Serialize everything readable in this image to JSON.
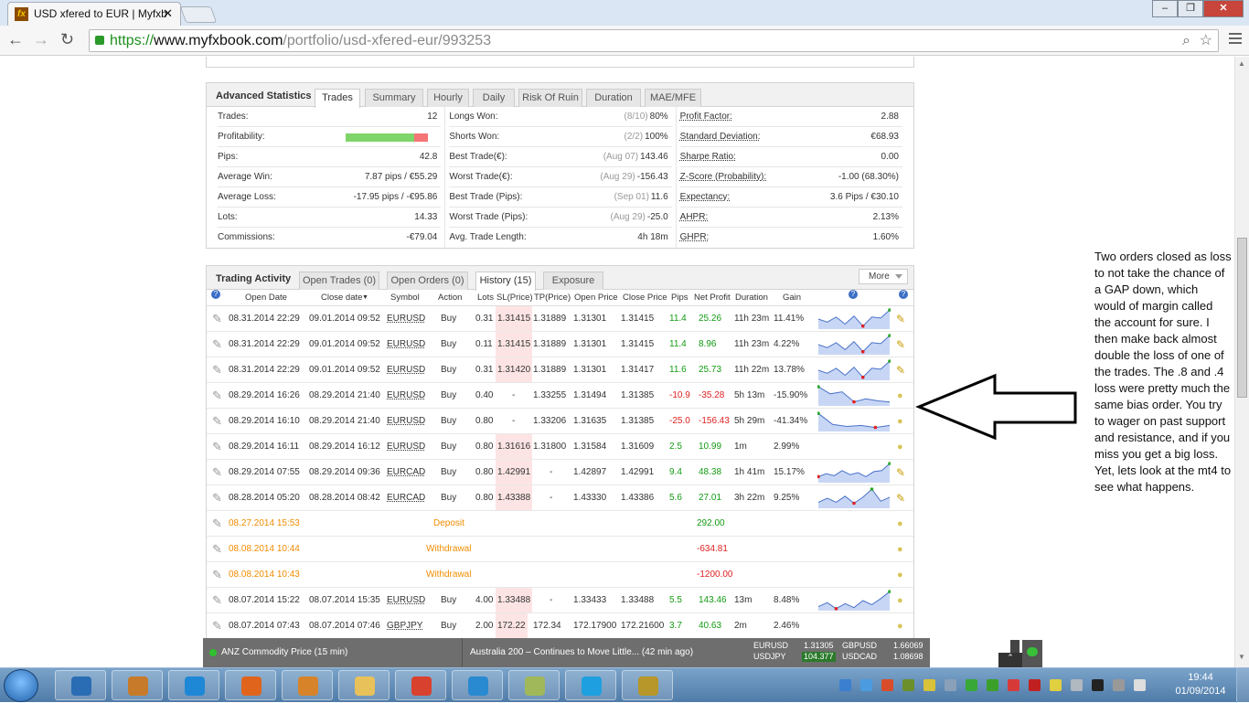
{
  "browser": {
    "tab_title": "USD xfered to EUR | Myfxb",
    "url_scheme": "https://",
    "url_host": "www.myfxbook.com",
    "url_path": "/portfolio/usd-xfered-eur/993253"
  },
  "advanced_statistics": {
    "title": "Advanced Statistics",
    "tabs": [
      "Trades",
      "Summary",
      "Hourly",
      "Daily",
      "Risk Of Ruin",
      "Duration",
      "MAE/MFE"
    ],
    "active_tab": "Trades",
    "col1": [
      {
        "label": "Trades:",
        "value": "12"
      },
      {
        "label": "Profitability:",
        "value": ""
      },
      {
        "label": "Pips:",
        "value": "42.8"
      },
      {
        "label": "Average Win:",
        "value": "7.87 pips / €55.29"
      },
      {
        "label": "Average Loss:",
        "value": "-17.95 pips / -€95.86"
      },
      {
        "label": "Lots:",
        "value": "14.33"
      },
      {
        "label": "Commissions:",
        "value": "-€79.04"
      }
    ],
    "profitability_fraction": 0.83,
    "col2": [
      {
        "label": "Longs Won:",
        "gray": "(8/10)",
        "value": "80%"
      },
      {
        "label": "Shorts Won:",
        "gray": "(2/2)",
        "value": "100%"
      },
      {
        "label": "Best Trade(€):",
        "gray": "(Aug 07)",
        "value": "143.46"
      },
      {
        "label": "Worst Trade(€):",
        "gray": "(Aug 29)",
        "value": "-156.43"
      },
      {
        "label": "Best Trade (Pips):",
        "gray": "(Sep 01)",
        "value": "11.6"
      },
      {
        "label": "Worst Trade (Pips):",
        "gray": "(Aug 29)",
        "value": "-25.0"
      },
      {
        "label": "Avg. Trade Length:",
        "gray": "",
        "value": "4h 18m"
      }
    ],
    "col3": [
      {
        "label": "Profit Factor:",
        "value": "2.88"
      },
      {
        "label": "Standard Deviation:",
        "value": "€68.93"
      },
      {
        "label": "Sharpe Ratio:",
        "value": "0.00"
      },
      {
        "label": "Z-Score (Probability):",
        "value": "-1.00 (68.30%)"
      },
      {
        "label": "Expectancy:",
        "value": "3.6 Pips / €30.10"
      },
      {
        "label": "AHPR:",
        "value": "2.13%"
      },
      {
        "label": "GHPR:",
        "value": "1.60%"
      }
    ]
  },
  "trading_activity": {
    "title": "Trading Activity",
    "tabs": [
      "Open Trades (0)",
      "Open Orders (0)",
      "History (15)",
      "Exposure"
    ],
    "active_tab": "History (15)",
    "more_label": "More",
    "columns": [
      "Open Date",
      "Close date",
      "Symbol",
      "Action",
      "Lots",
      "SL(Price)",
      "TP(Price)",
      "Open Price",
      "Close Price",
      "Pips",
      "Net Profit",
      "Duration",
      "Gain"
    ],
    "rows": [
      {
        "open": "08.31.2014 22:29",
        "close": "09.01.2014 09:52",
        "symbol": "EURUSD",
        "action": "Buy",
        "lots": "0.31",
        "sl": "1.31415",
        "tp": "1.31889",
        "op": "1.31301",
        "cp": "1.31415",
        "pips": "11.4",
        "profit": "25.26",
        "dur": "11h 23m",
        "gain": "11.41%",
        "spark": [
          0.5,
          0.35,
          0.6,
          0.25,
          0.65,
          0.15,
          0.6,
          0.55,
          0.95
        ],
        "icon": "edit"
      },
      {
        "open": "08.31.2014 22:29",
        "close": "09.01.2014 09:52",
        "symbol": "EURUSD",
        "action": "Buy",
        "lots": "0.11",
        "sl": "1.31415",
        "tp": "1.31889",
        "op": "1.31301",
        "cp": "1.31415",
        "pips": "11.4",
        "profit": "8.96",
        "dur": "11h 23m",
        "gain": "4.22%",
        "spark": [
          0.5,
          0.35,
          0.6,
          0.25,
          0.65,
          0.15,
          0.6,
          0.55,
          0.95
        ],
        "icon": "edit"
      },
      {
        "open": "08.31.2014 22:29",
        "close": "09.01.2014 09:52",
        "symbol": "EURUSD",
        "action": "Buy",
        "lots": "0.31",
        "sl": "1.31420",
        "tp": "1.31889",
        "op": "1.31301",
        "cp": "1.31417",
        "pips": "11.6",
        "profit": "25.73",
        "dur": "11h 22m",
        "gain": "13.78%",
        "spark": [
          0.5,
          0.35,
          0.6,
          0.25,
          0.65,
          0.15,
          0.6,
          0.55,
          0.95
        ],
        "icon": "edit"
      },
      {
        "open": "08.29.2014 16:26",
        "close": "08.29.2014 21:40",
        "symbol": "EURUSD",
        "action": "Buy",
        "lots": "0.40",
        "sl": "-",
        "tp": "1.33255",
        "op": "1.31494",
        "cp": "1.31385",
        "pips": "-10.9",
        "profit": "-35.28",
        "dur": "5h 13m",
        "gain": "-15.90%",
        "spark": [
          0.95,
          0.6,
          0.7,
          0.2,
          0.35,
          0.25,
          0.2
        ],
        "icon": "note"
      },
      {
        "open": "08.29.2014 16:10",
        "close": "08.29.2014 21:40",
        "symbol": "EURUSD",
        "action": "Buy",
        "lots": "0.80",
        "sl": "-",
        "tp": "1.33206",
        "op": "1.31635",
        "cp": "1.31385",
        "pips": "-25.0",
        "profit": "-156.43",
        "dur": "5h 29m",
        "gain": "-41.34%",
        "spark": [
          0.9,
          0.35,
          0.25,
          0.3,
          0.2,
          0.3
        ],
        "icon": "note"
      },
      {
        "open": "08.29.2014 16:11",
        "close": "08.29.2014 16:12",
        "symbol": "EURUSD",
        "action": "Buy",
        "lots": "0.80",
        "sl": "1.31616",
        "tp": "1.31800",
        "op": "1.31584",
        "cp": "1.31609",
        "pips": "2.5",
        "profit": "10.99",
        "dur": "1m",
        "gain": "2.99%",
        "spark": [],
        "icon": "note"
      },
      {
        "open": "08.29.2014 07:55",
        "close": "08.29.2014 09:36",
        "symbol": "EURCAD",
        "action": "Buy",
        "lots": "0.80",
        "sl": "1.42991",
        "tp": "-",
        "op": "1.42897",
        "cp": "1.42991",
        "pips": "9.4",
        "profit": "48.38",
        "dur": "1h 41m",
        "gain": "15.17%",
        "spark": [
          0.3,
          0.45,
          0.35,
          0.6,
          0.4,
          0.5,
          0.3,
          0.55,
          0.6,
          0.95
        ],
        "icon": "edit"
      },
      {
        "open": "08.28.2014 05:20",
        "close": "08.28.2014 08:42",
        "symbol": "EURCAD",
        "action": "Buy",
        "lots": "0.80",
        "sl": "1.43388",
        "tp": "-",
        "op": "1.43330",
        "cp": "1.43386",
        "pips": "5.6",
        "profit": "27.01",
        "dur": "3h 22m",
        "gain": "9.25%",
        "spark": [
          0.3,
          0.5,
          0.3,
          0.6,
          0.25,
          0.55,
          0.95,
          0.35,
          0.55
        ],
        "icon": "edit"
      },
      {
        "type": "deposit",
        "open": "08.27.2014 15:53",
        "action": "Deposit",
        "profit": "292.00",
        "icon": "note"
      },
      {
        "type": "withdrawal",
        "open": "08.08.2014 10:44",
        "action": "Withdrawal",
        "profit": "-634.81",
        "icon": "note"
      },
      {
        "type": "withdrawal",
        "open": "08.08.2014 10:43",
        "action": "Withdrawal",
        "profit": "-1200.00",
        "icon": "note"
      },
      {
        "open": "08.07.2014 15:22",
        "close": "08.07.2014 15:35",
        "symbol": "EURUSD",
        "action": "Buy",
        "lots": "4.00",
        "sl": "1.33488",
        "tp": "-",
        "op": "1.33433",
        "cp": "1.33488",
        "pips": "5.5",
        "profit": "143.46",
        "dur": "13m",
        "gain": "8.48%",
        "spark": [
          0.2,
          0.4,
          0.1,
          0.35,
          0.15,
          0.5,
          0.3,
          0.6,
          0.95
        ],
        "icon": "note"
      },
      {
        "open": "08.07.2014 07:43",
        "close": "08.07.2014 07:46",
        "symbol": "GBPJPY",
        "action": "Buy",
        "lots": "2.00",
        "sl": "172.22",
        "tp": "172.34",
        "op": "172.17900",
        "cp": "172.21600",
        "pips": "3.7",
        "profit": "40.63",
        "dur": "2m",
        "gain": "2.46%",
        "spark": [],
        "icon": "note"
      }
    ]
  },
  "news_bar": {
    "item1": "ANZ Commodity Price (15 min)",
    "item2": "Australia 200 – Continues to Move Little... (42 min ago)",
    "quotes": [
      {
        "symbol": "EURUSD",
        "value": "1.31305"
      },
      {
        "symbol": "USDJPY",
        "value": "104.377"
      },
      {
        "symbol": "GBPUSD",
        "value": "1.66069"
      },
      {
        "symbol": "USDCAD",
        "value": "1.08698"
      }
    ]
  },
  "annotation": "Two orders closed as loss to not take the chance of a GAP down, which would of margin called the account for sure.  I then make back almost double the loss of one of the trades. The .8 and .4 loss were pretty much the same bias order. You try to wager on past support and resistance, and if you miss you get a big loss. Yet, lets look at the mt4 to see what happens.",
  "taskbar": {
    "time": "19:44",
    "date": "01/09/2014",
    "pinned": [
      "hp-icon",
      "folder-app-icon",
      "ie-icon",
      "firefox-icon",
      "media-player-icon",
      "explorer-icon",
      "chrome-icon",
      "network-icon",
      "sticky-icon",
      "skype-icon",
      "lion-app-icon"
    ]
  },
  "colors": {
    "positive": "#129b12",
    "negative": "#e02020",
    "orange": "#f08c00",
    "sl_highlight": "#fde4e4",
    "spark_fill": "#c8d6f5",
    "spark_line": "#4a72c9"
  }
}
